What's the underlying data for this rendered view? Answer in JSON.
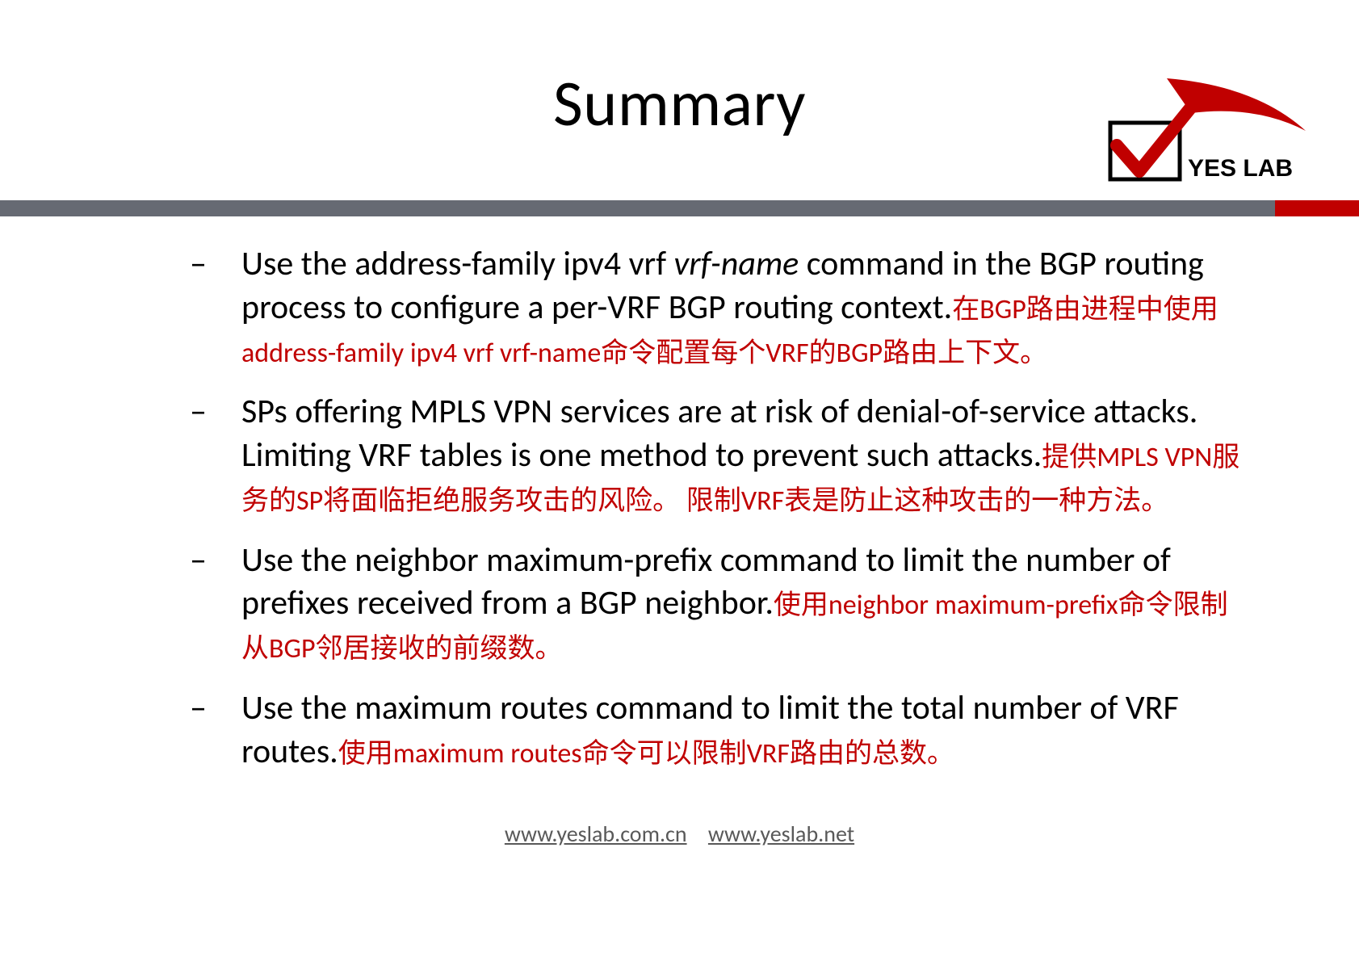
{
  "title": "Summary",
  "logo": {
    "brand_text": "YES LAB"
  },
  "bullets": [
    {
      "en_pre": "Use the address-family ipv4 vrf ",
      "en_italic": "vrf-name",
      "en_post": " command in the BGP routing process to configure a per-VRF BGP routing context.",
      "zh": "在BGP路由进程中使用address-family ipv4 vrf vrf-name命令配置每个VRF的BGP路由上下文。"
    },
    {
      "en_pre": "SPs offering MPLS VPN services are at risk of denial-of-service attacks. Limiting VRF tables is one method to prevent such attacks.",
      "en_italic": "",
      "en_post": "",
      "zh": "提供MPLS VPN服务的SP将面临拒绝服务攻击的风险。 限制VRF表是防止这种攻击的一种方法。"
    },
    {
      "en_pre": "Use the neighbor maximum-prefix command to limit the number of prefixes received from a BGP neighbor.",
      "en_italic": "",
      "en_post": "",
      "zh": "使用neighbor maximum-prefix命令限制从BGP邻居接收的前缀数。"
    },
    {
      "en_pre": "Use the maximum routes command to limit the total number of VRF routes.",
      "en_italic": "",
      "en_post": "",
      "zh": "使用maximum routes命令可以限制VRF路由的总数。"
    }
  ],
  "footer": {
    "link1": "www.yeslab.com.cn",
    "link2": "www.yeslab.net"
  },
  "colors": {
    "accent_red": "#c00000",
    "bar_grey": "#666a73",
    "text_black": "#000000",
    "footer_grey": "#595959"
  }
}
